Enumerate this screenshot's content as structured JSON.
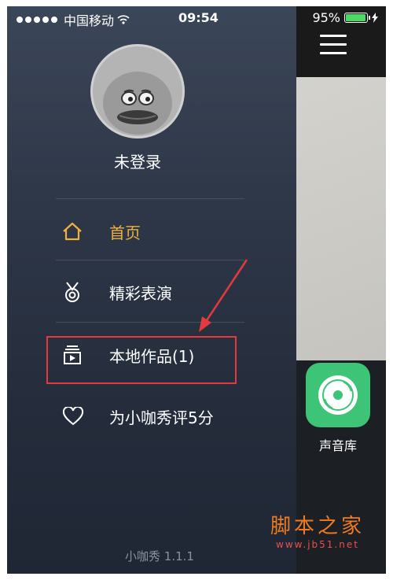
{
  "status_bar": {
    "carrier": "中国移动",
    "time": "09:54",
    "battery": "95%",
    "battery_level": 0.95
  },
  "drawer": {
    "login_label": "未登录",
    "menu": [
      {
        "label": "首页",
        "icon": "home-icon",
        "active": true
      },
      {
        "label": "精彩表演",
        "icon": "medal-icon",
        "active": false
      },
      {
        "label": "本地作品(1)",
        "icon": "local-works-icon",
        "active": false
      },
      {
        "label": "为小咖秀评5分",
        "icon": "heart-icon",
        "active": false
      }
    ],
    "version": "小咖秀 1.1.1"
  },
  "main": {
    "menu_icon": "hamburger-icon",
    "sound_library_label": "声音库"
  },
  "watermark": {
    "title": "脚本之家",
    "url": "www.jb51.net"
  },
  "colors": {
    "accent": "#f1b03b",
    "highlight": "#e23a3e",
    "green": "#3dc477"
  }
}
